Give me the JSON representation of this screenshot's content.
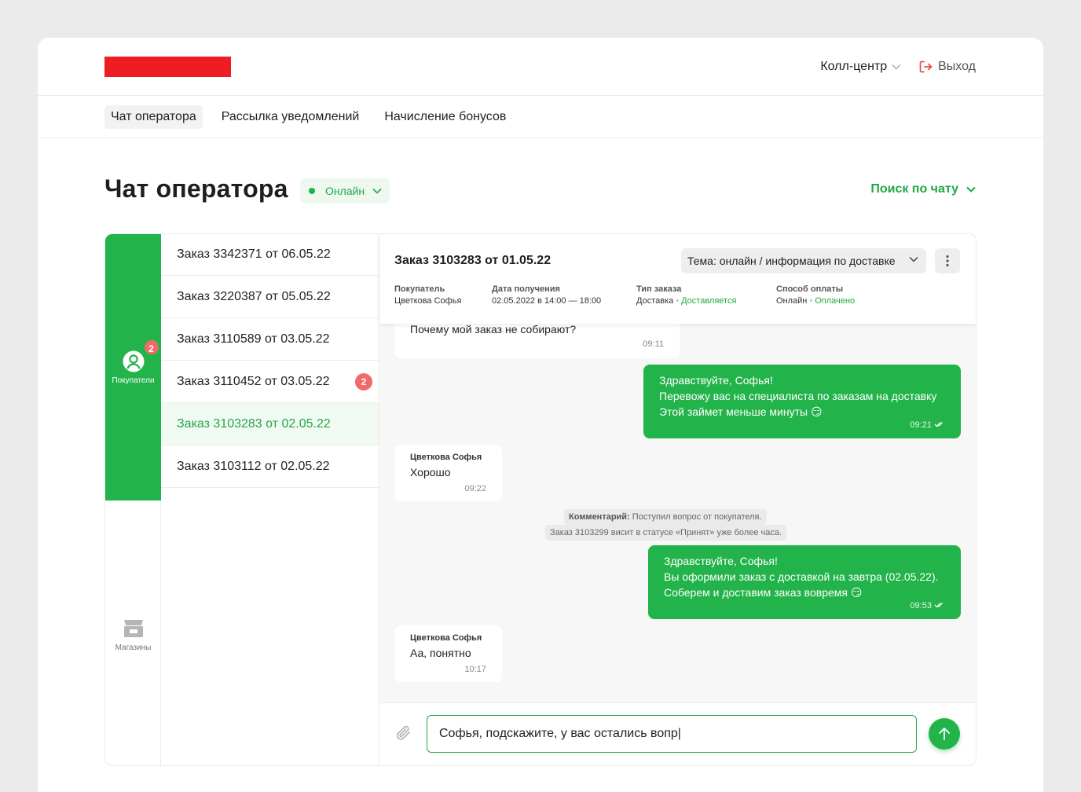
{
  "header": {
    "brand_color": "#ee1d23",
    "role": "Колл-центр",
    "logout": "Выход"
  },
  "nav": [
    {
      "label": "Чат оператора",
      "active": true
    },
    {
      "label": "Рассылка уведомлений"
    },
    {
      "label": "Начисление бонусов"
    }
  ],
  "page": {
    "title": "Чат оператора",
    "status": "Онлайн",
    "search_chat": "Поиск по чату"
  },
  "rail": {
    "buyers_label": "Покупатели",
    "buyers_badge": "2",
    "shops_label": "Магазины"
  },
  "orders": [
    {
      "label": "Заказ 3342371 от 06.05.22"
    },
    {
      "label": "Заказ 3220387 от 05.05.22"
    },
    {
      "label": "Заказ 3110589 от 03.05.22"
    },
    {
      "label": "Заказ 3110452 от 03.05.22",
      "badge": "2"
    },
    {
      "label": "Заказ 3103283 от 02.05.22",
      "active": true
    },
    {
      "label": "Заказ 3103112 от 02.05.22"
    }
  ],
  "chat": {
    "title": "Заказ 3103283 от 01.05.22",
    "topic": "Тема: онлайн / информация по доставке",
    "meta": {
      "buyer_label": "Покупатель",
      "buyer": "Цветкова Софья",
      "date_label": "Дата получения",
      "date": "02.05.2022 в 14:00 — 18:00",
      "type_label": "Тип заказа",
      "type": "Доставка",
      "type_status": "Доставляется",
      "pay_label": "Способ оплаты",
      "pay": "Онлайн",
      "pay_status": "Оплачено"
    },
    "messages": {
      "m1": {
        "text": "Почему мой заказ не собирают?",
        "time": "09:11"
      },
      "m2": {
        "line1": "Здравствуйте, Софья!",
        "line2": "Перевожу вас на специалиста по заказам на доставку",
        "line3": "Этой займет меньше минуты 😏",
        "time": "09:21"
      },
      "m3": {
        "author": "Цветкова Софья",
        "text": "Хорошо",
        "time": "09:22"
      },
      "comment": {
        "label": "Комментарий:",
        "line1": " Поступил вопрос от покупателя.",
        "line2": "Заказ 3103299 висит в статусе «Принят» уже более часа."
      },
      "m4": {
        "line1": "Здравствуйте, Софья!",
        "line2": "Вы оформили заказ с доставкой на завтра (02.05.22).",
        "line3": "Соберем и доставим заказ вовремя 😏",
        "time": "09:53"
      },
      "m5": {
        "author": "Цветкова Софья",
        "text": "Аа, понятно",
        "time": "10:17"
      }
    },
    "input_value": "Софья, подскажите, у вас остались вопр|"
  },
  "colors": {
    "accent": "#22b34a",
    "badge": "#f06a6a"
  }
}
